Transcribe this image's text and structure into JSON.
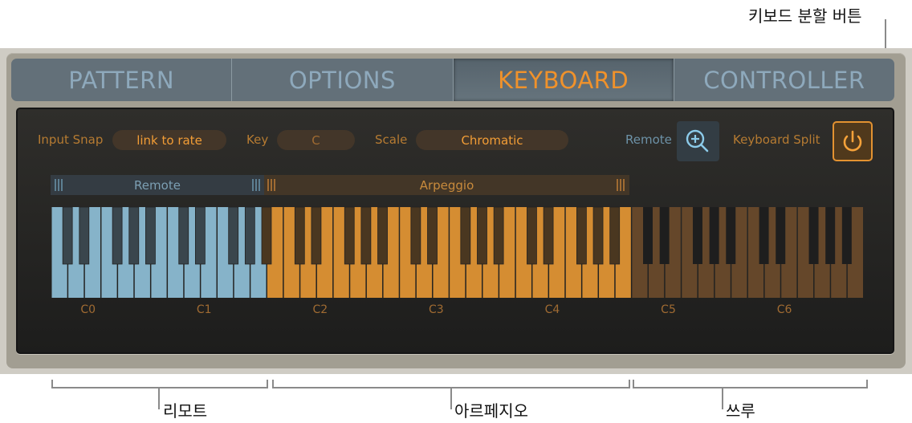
{
  "callouts": {
    "keyboard_split_button": "키보드 분할 버튼",
    "remote": "리모트",
    "arpeggio": "아르페지오",
    "thru": "쓰루"
  },
  "tabs": [
    {
      "label": "PATTERN",
      "active": false
    },
    {
      "label": "OPTIONS",
      "active": false
    },
    {
      "label": "KEYBOARD",
      "active": true
    },
    {
      "label": "CONTROLLER",
      "active": false
    }
  ],
  "controls": {
    "input_snap_label": "Input Snap",
    "input_snap_value": "link to rate",
    "key_label": "Key",
    "key_value": "C",
    "scale_label": "Scale",
    "scale_value": "Chromatic",
    "remote_label": "Remote",
    "remote_icon": "zoom-in-icon",
    "keyboard_split_label": "Keyboard Split",
    "keyboard_split_icon": "power-icon",
    "keyboard_split_on": true
  },
  "zones": {
    "remote": {
      "label": "Remote",
      "range": [
        "C0",
        "A1"
      ]
    },
    "arpeggio": {
      "label": "Arpeggio",
      "range": [
        "A#1",
        "B4"
      ]
    },
    "thru": {
      "range": [
        "C5",
        "B6"
      ]
    }
  },
  "keyboard": {
    "start_octave": 0,
    "octaves": 7,
    "octave_labels": [
      "C0",
      "C1",
      "C2",
      "C3",
      "C4",
      "C5",
      "C6"
    ],
    "colors": {
      "remote_white": "#86b3c9",
      "remote_black": "#3a464d",
      "arp_white": "#d58d32",
      "arp_black": "#4a3720",
      "thru_white": "#65472a",
      "thru_black": "#1e1e1e"
    }
  }
}
